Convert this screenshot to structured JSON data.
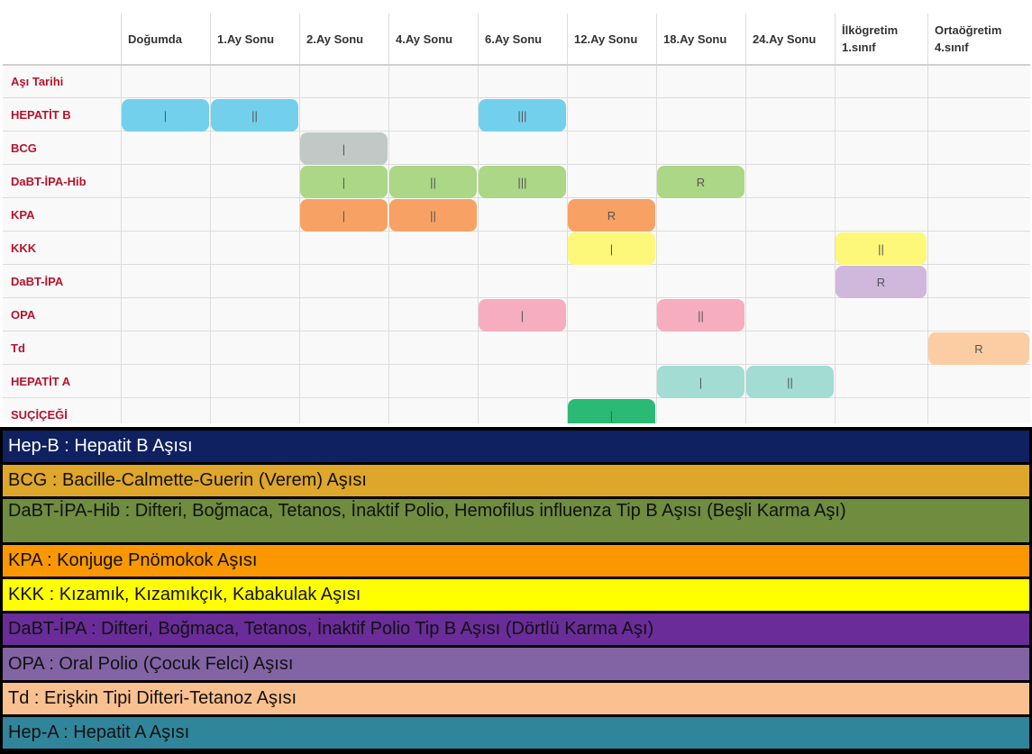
{
  "header": {
    "empty": "",
    "columns": [
      "Doğumda",
      "1.Ay Sonu",
      "2.Ay Sonu",
      "4.Ay Sonu",
      "6.Ay Sonu",
      "12.Ay Sonu",
      "18.Ay Sonu",
      "24.Ay Sonu",
      "İlkögretim 1.sınıf",
      "Ortaöğretim 4.sınıf"
    ]
  },
  "rows": [
    {
      "label": "Aşı Tarihi",
      "doses": []
    },
    {
      "label": "HEPATİT B",
      "doses": [
        {
          "col": 0,
          "text": "|",
          "color": "#72d0ed"
        },
        {
          "col": 1,
          "text": "||",
          "color": "#72d0ed"
        },
        {
          "col": 4,
          "text": "|||",
          "color": "#72d0ed"
        }
      ]
    },
    {
      "label": "BCG",
      "doses": [
        {
          "col": 2,
          "text": "|",
          "color": "#c1c8c5"
        }
      ]
    },
    {
      "label": "DaBT-İPA-Hib",
      "doses": [
        {
          "col": 2,
          "text": "|",
          "color": "#abd786"
        },
        {
          "col": 3,
          "text": "||",
          "color": "#abd786"
        },
        {
          "col": 4,
          "text": "|||",
          "color": "#abd786"
        },
        {
          "col": 6,
          "text": "R",
          "color": "#abd786"
        }
      ]
    },
    {
      "label": "KPA",
      "doses": [
        {
          "col": 2,
          "text": "|",
          "color": "#f7a264"
        },
        {
          "col": 3,
          "text": "||",
          "color": "#f7a264"
        },
        {
          "col": 5,
          "text": "R",
          "color": "#f7a264"
        }
      ]
    },
    {
      "label": "KKK",
      "doses": [
        {
          "col": 5,
          "text": "|",
          "color": "#fdf879"
        },
        {
          "col": 8,
          "text": "||",
          "color": "#fdf879"
        }
      ]
    },
    {
      "label": "DaBT-İPA",
      "doses": [
        {
          "col": 8,
          "text": "R",
          "color": "#d0b7dc"
        }
      ]
    },
    {
      "label": "OPA",
      "doses": [
        {
          "col": 4,
          "text": "|",
          "color": "#f7adc0"
        },
        {
          "col": 6,
          "text": "||",
          "color": "#f7adc0"
        }
      ]
    },
    {
      "label": "Td",
      "doses": [
        {
          "col": 9,
          "text": "R",
          "color": "#fccda2"
        }
      ]
    },
    {
      "label": "HEPATİT A",
      "doses": [
        {
          "col": 6,
          "text": "|",
          "color": "#a3dcd3"
        },
        {
          "col": 7,
          "text": "||",
          "color": "#a3dcd3"
        }
      ]
    },
    {
      "label": "SUÇİÇEĞİ",
      "doses": [
        {
          "col": 5,
          "text": "|",
          "color": "#2bba75"
        }
      ]
    }
  ],
  "legend": [
    {
      "text": "Hep-B : Hepatit B Aşısı",
      "color": "#0f2160",
      "text_color": "#ffffff"
    },
    {
      "text": "BCG : Bacille-Calmette-Guerin (Verem) Aşısı",
      "color": "#dea62a",
      "text_color": "#111111"
    },
    {
      "text": "DaBT-İPA-Hib : Difteri, Boğmaca, Tetanos, İnaktif Polio, Hemofilus influenza Tip B Aşısı (Beşli Karma Aşı)",
      "color": "#6f8c3f",
      "text_color": "#111111"
    },
    {
      "text": "KPA : Konjuge Pnömokok Aşısı",
      "color": "#fb9700",
      "text_color": "#111111"
    },
    {
      "text": "KKK : Kızamık, Kızamıkçık, Kabakulak Aşısı",
      "color": "#ffff00",
      "text_color": "#111111"
    },
    {
      "text": "DaBT-İPA : Difteri, Boğmaca, Tetanos, İnaktif Polio Tip B Aşısı (Dörtlü Karma Aşı)",
      "color": "#6a2c99",
      "text_color": "#111111"
    },
    {
      "text": "OPA : Oral Polio (Çocuk Felci) Aşısı",
      "color": "#8264a4",
      "text_color": "#111111"
    },
    {
      "text": "Td : Erişkin Tipi Difteri-Tetanoz Aşısı",
      "color": "#fac08f",
      "text_color": "#111111"
    },
    {
      "text": "Hep-A : Hepatit A Aşısı",
      "color": "#30859a",
      "text_color": "#111111"
    }
  ]
}
